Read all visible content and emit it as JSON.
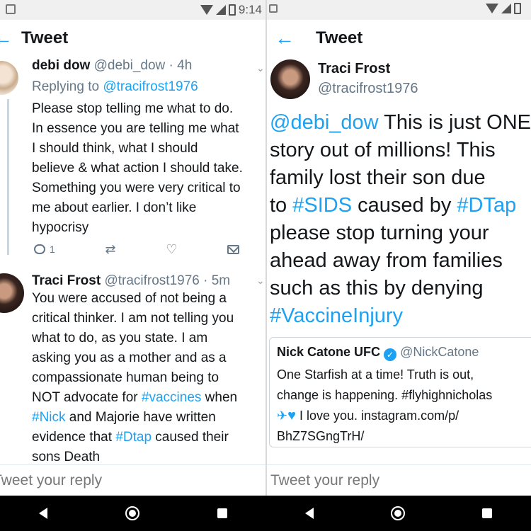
{
  "status_bar": {
    "time": "9:14"
  },
  "left_panel": {
    "header": {
      "back_icon": "arrow-left-icon",
      "title": "Tweet"
    },
    "tweet1": {
      "name": "debi dow",
      "handle": "@debi_dow",
      "time": "· 4h",
      "replying_prefix": "Replying to",
      "replying_to": "@tracifrost1976",
      "text_lines": [
        "Please stop telling me what to do.",
        "In essence you are telling me what",
        "I should think, what I should",
        "believe & what action I should take.",
        "Something you were very critical to",
        "me about earlier.  I don’t like",
        "hypocrisy"
      ],
      "reply_count": "1"
    },
    "tweet2": {
      "name": "Traci Frost",
      "handle": "@tracifrost1976",
      "time": "· 5m",
      "lines": [
        [
          {
            "t": "You were accused of not being a"
          }
        ],
        [
          {
            "t": "critical thinker. I am not telling you"
          }
        ],
        [
          {
            "t": "what to do, as you state. I am"
          }
        ],
        [
          {
            "t": "asking you as  a mother and as a"
          }
        ],
        [
          {
            "t": "compassionate human being to"
          }
        ],
        [
          {
            "t": "NOT advocate for "
          },
          {
            "t": "#vaccines",
            "link": true
          },
          {
            "t": " when"
          }
        ],
        [
          {
            "t": "#Nick",
            "link": true
          },
          {
            "t": " and Majorie have written"
          }
        ],
        [
          {
            "t": "evidence that "
          },
          {
            "t": "#Dtap",
            "link": true
          },
          {
            "t": " caused their"
          }
        ],
        [
          {
            "t": "sons Death"
          }
        ]
      ]
    },
    "reply_placeholder": "Tweet your reply"
  },
  "right_panel": {
    "header": {
      "back_icon": "arrow-left-icon",
      "title": "Tweet"
    },
    "tweet": {
      "name": "Traci Frost",
      "handle": "@tracifrost1976",
      "lines": [
        [
          {
            "t": "@debi_dow",
            "link": true
          },
          {
            "t": " This is just ONE"
          }
        ],
        [
          {
            "t": "story out of millions! This"
          }
        ],
        [
          {
            "t": "family lost their son due"
          }
        ],
        [
          {
            "t": "to "
          },
          {
            "t": "#SIDS",
            "link": true
          },
          {
            "t": " caused by "
          },
          {
            "t": "#DTap",
            "link": true
          }
        ],
        [
          {
            "t": "please stop turning your"
          }
        ],
        [
          {
            "t": "ahead away from families"
          }
        ],
        [
          {
            "t": "such as this by denying"
          }
        ],
        [
          {
            "t": "#VaccineInjury",
            "link": true
          }
        ]
      ]
    },
    "quoted": {
      "name": "Nick Catone UFC",
      "handle": "@NickCatone",
      "line1": "One Starfish at a time! Truth is out,",
      "line2": "change is happening. #flyhighnicholas",
      "line3": "I love you. instagram.com/p/",
      "line4": "BhZ7SGngTrH/"
    },
    "reply_placeholder": "Tweet your reply"
  },
  "colors": {
    "link": "#1da1f2",
    "text": "#14171a",
    "muted": "#657786"
  }
}
